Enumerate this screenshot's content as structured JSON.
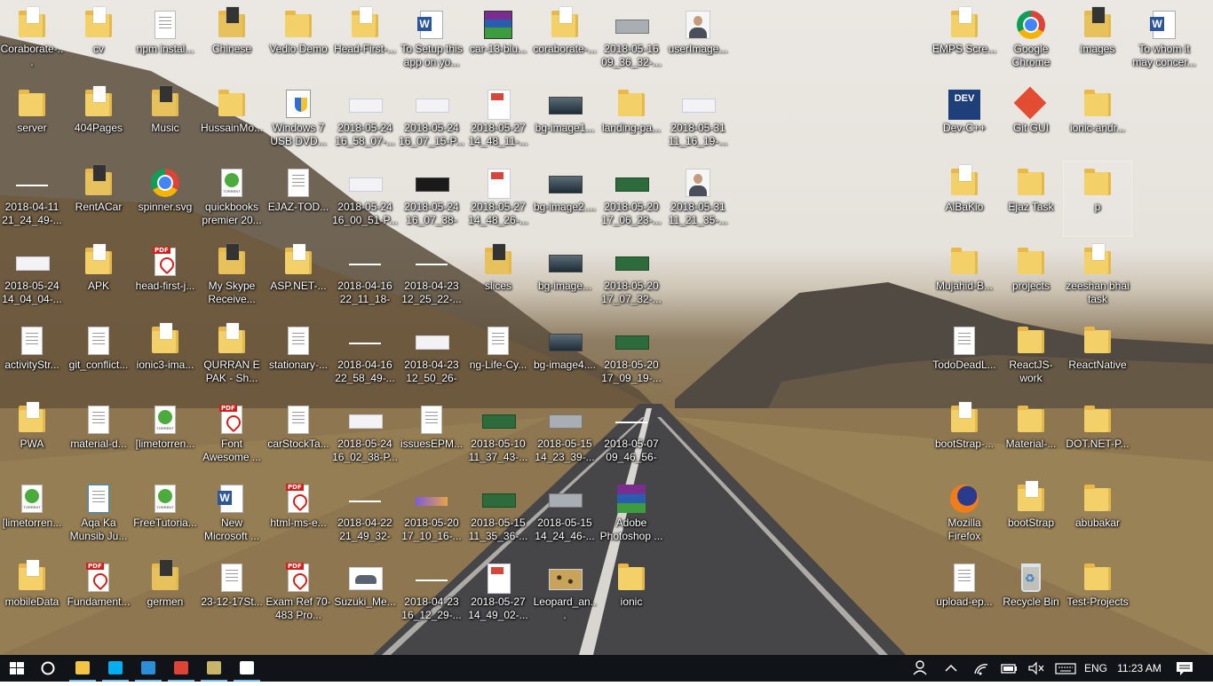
{
  "desktop": {
    "icons": [
      {
        "col": 0,
        "row": 0,
        "label": "Coraborate-...",
        "type": "folder-doc"
      },
      {
        "col": 1,
        "row": 0,
        "label": "cv",
        "type": "folder-doc"
      },
      {
        "col": 2,
        "row": 0,
        "label": "npm instal...",
        "type": "doc"
      },
      {
        "col": 3,
        "row": 0,
        "label": "Chinese",
        "type": "folder-media"
      },
      {
        "col": 4,
        "row": 0,
        "label": "Vedio Demo",
        "type": "folder"
      },
      {
        "col": 5,
        "row": 0,
        "label": "Head-First-...",
        "type": "folder-doc"
      },
      {
        "col": 6,
        "row": 0,
        "label": "To Setup this app on yo...",
        "type": "word"
      },
      {
        "col": 7,
        "row": 0,
        "label": "car-13-blu...",
        "type": "winrar"
      },
      {
        "col": 8,
        "row": 0,
        "label": "coraborate-...",
        "type": "folder-doc"
      },
      {
        "col": 9,
        "row": 0,
        "label": "2018-05-16 09_36_32-...",
        "type": "thumb-grey"
      },
      {
        "col": 10,
        "row": 0,
        "label": "userImage...",
        "type": "avatar"
      },
      {
        "col": 0,
        "row": 1,
        "label": "server",
        "type": "folder"
      },
      {
        "col": 1,
        "row": 1,
        "label": "404Pages",
        "type": "folder-doc"
      },
      {
        "col": 2,
        "row": 1,
        "label": "Music",
        "type": "folder-media"
      },
      {
        "col": 3,
        "row": 1,
        "label": "HussainMo...",
        "type": "folder"
      },
      {
        "col": 4,
        "row": 1,
        "label": "Windows 7 USB DVD...",
        "type": "shield"
      },
      {
        "col": 5,
        "row": 1,
        "label": "2018-05-24 16_58_07-...",
        "type": "thumb"
      },
      {
        "col": 6,
        "row": 1,
        "label": "2018-05-24 16_07_15-P...",
        "type": "thumb"
      },
      {
        "col": 7,
        "row": 1,
        "label": "2018-05-27 14_48_11-...",
        "type": "thumb-tall"
      },
      {
        "col": 8,
        "row": 1,
        "label": "bg-image1...",
        "type": "thumb-photo"
      },
      {
        "col": 9,
        "row": 1,
        "label": "landing-pa...",
        "type": "folder"
      },
      {
        "col": 10,
        "row": 1,
        "label": "2018-05-31 11_16_19-...",
        "type": "thumb"
      },
      {
        "col": 0,
        "row": 2,
        "label": "2018-04-11 21_24_49-...",
        "type": "thumb-line"
      },
      {
        "col": 1,
        "row": 2,
        "label": "RentACar",
        "type": "folder-media"
      },
      {
        "col": 2,
        "row": 2,
        "label": "spinner.svg",
        "type": "chrome"
      },
      {
        "col": 3,
        "row": 2,
        "label": "quickbooks premier 20...",
        "type": "torrent"
      },
      {
        "col": 4,
        "row": 2,
        "label": "EJAZ-TOD...",
        "type": "doc"
      },
      {
        "col": 5,
        "row": 2,
        "label": "2018-05-24 16_00_51-P...",
        "type": "thumb"
      },
      {
        "col": 6,
        "row": 2,
        "label": "2018-05-24 16_07_38-H...",
        "type": "thumb-dark"
      },
      {
        "col": 7,
        "row": 2,
        "label": "2018-05-27 14_48_26-...",
        "type": "thumb-tall"
      },
      {
        "col": 8,
        "row": 2,
        "label": "bg-image2....",
        "type": "thumb-photo"
      },
      {
        "col": 9,
        "row": 2,
        "label": "2018-05-20 17_06_23-...",
        "type": "thumb-green"
      },
      {
        "col": 10,
        "row": 2,
        "label": "2018-05-31 11_21_35-...",
        "type": "avatar"
      },
      {
        "col": 0,
        "row": 3,
        "label": "2018-05-24 14_04_04-...",
        "type": "thumb"
      },
      {
        "col": 1,
        "row": 3,
        "label": "APK",
        "type": "folder-doc"
      },
      {
        "col": 2,
        "row": 3,
        "label": "head-first-j...",
        "type": "pdf"
      },
      {
        "col": 3,
        "row": 3,
        "label": "My Skype Receive...",
        "type": "folder-media"
      },
      {
        "col": 4,
        "row": 3,
        "label": "ASP.NET-...",
        "type": "folder-doc"
      },
      {
        "col": 5,
        "row": 3,
        "label": "2018-04-16 22_11_18-M...",
        "type": "thumb-line"
      },
      {
        "col": 6,
        "row": 3,
        "label": "2018-04-23 12_25_22-...",
        "type": "thumb-line"
      },
      {
        "col": 7,
        "row": 3,
        "label": "slices",
        "type": "folder-media"
      },
      {
        "col": 8,
        "row": 3,
        "label": "bg-image...",
        "type": "thumb-photo"
      },
      {
        "col": 9,
        "row": 3,
        "label": "2018-05-20 17_07_32-...",
        "type": "thumb-green"
      },
      {
        "col": 0,
        "row": 4,
        "label": "activityStr...",
        "type": "doc"
      },
      {
        "col": 1,
        "row": 4,
        "label": "git_conflict...",
        "type": "doc"
      },
      {
        "col": 2,
        "row": 4,
        "label": "ionic3-ima...",
        "type": "folder-doc"
      },
      {
        "col": 3,
        "row": 4,
        "label": "QURRAN E PAK - Sh...",
        "type": "folder-doc"
      },
      {
        "col": 4,
        "row": 4,
        "label": "stationary-...",
        "type": "doc"
      },
      {
        "col": 5,
        "row": 4,
        "label": "2018-04-16 22_58_49-...",
        "type": "thumb-line"
      },
      {
        "col": 6,
        "row": 4,
        "label": "2018-04-23 12_50_26-M...",
        "type": "thumb"
      },
      {
        "col": 7,
        "row": 4,
        "label": "ng-Life-Cy...",
        "type": "doc"
      },
      {
        "col": 8,
        "row": 4,
        "label": "bg-image4....",
        "type": "thumb-photo"
      },
      {
        "col": 9,
        "row": 4,
        "label": "2018-05-20 17_09_19-...",
        "type": "thumb-green"
      },
      {
        "col": 0,
        "row": 5,
        "label": "PWA",
        "type": "folder-doc"
      },
      {
        "col": 1,
        "row": 5,
        "label": "material-d...",
        "type": "doc"
      },
      {
        "col": 2,
        "row": 5,
        "label": "[limetorren...",
        "type": "torrent"
      },
      {
        "col": 3,
        "row": 5,
        "label": "Font Awesome ...",
        "type": "pdf"
      },
      {
        "col": 4,
        "row": 5,
        "label": "carStockTa...",
        "type": "doc"
      },
      {
        "col": 5,
        "row": 5,
        "label": "2018-05-24 16_02_38-P...",
        "type": "thumb"
      },
      {
        "col": 6,
        "row": 5,
        "label": "issuesEPM...",
        "type": "doc"
      },
      {
        "col": 7,
        "row": 5,
        "label": "2018-05-10 11_37_43-...",
        "type": "thumb-green"
      },
      {
        "col": 8,
        "row": 5,
        "label": "2018-05-15 14_23_39-...",
        "type": "thumb-grey"
      },
      {
        "col": 9,
        "row": 5,
        "label": "2018-05-07 09_46_56-ht...",
        "type": "thumb-line"
      },
      {
        "col": 0,
        "row": 6,
        "label": "[limetorren...",
        "type": "torrent"
      },
      {
        "col": 1,
        "row": 6,
        "label": "Aqa Ka Munsib Ju...",
        "type": "doc-blue"
      },
      {
        "col": 2,
        "row": 6,
        "label": "FreeTutoria...",
        "type": "torrent"
      },
      {
        "col": 3,
        "row": 6,
        "label": "New Microsoft ...",
        "type": "word"
      },
      {
        "col": 4,
        "row": 6,
        "label": "html-ms-e...",
        "type": "pdf"
      },
      {
        "col": 5,
        "row": 6,
        "label": "2018-04-22 21_49_32-H...",
        "type": "thumb-line"
      },
      {
        "col": 6,
        "row": 6,
        "label": "2018-05-20 17_10_16-...",
        "type": "thumb-bright"
      },
      {
        "col": 7,
        "row": 6,
        "label": "2018-05-15 11_35_36-...",
        "type": "thumb-green"
      },
      {
        "col": 8,
        "row": 6,
        "label": "2018-05-15 14_24_46-...",
        "type": "thumb-grey"
      },
      {
        "col": 9,
        "row": 6,
        "label": "Adobe Photoshop ...",
        "type": "ps"
      },
      {
        "col": 0,
        "row": 7,
        "label": "mobileData",
        "type": "folder-doc"
      },
      {
        "col": 1,
        "row": 7,
        "label": "Fundament...",
        "type": "pdf"
      },
      {
        "col": 2,
        "row": 7,
        "label": "germen",
        "type": "folder-media"
      },
      {
        "col": 3,
        "row": 7,
        "label": "23-12-17St...",
        "type": "doc"
      },
      {
        "col": 4,
        "row": 7,
        "label": "Exam Ref 70-483 Pro...",
        "type": "pdf"
      },
      {
        "col": 5,
        "row": 7,
        "label": "Suzuki_Me...",
        "type": "thumb-car"
      },
      {
        "col": 6,
        "row": 7,
        "label": "2018-04-23 16_12_29-...",
        "type": "thumb-line"
      },
      {
        "col": 7,
        "row": 7,
        "label": "2018-05-27 14_49_02-...",
        "type": "thumb-tall"
      },
      {
        "col": 8,
        "row": 7,
        "label": "Leopard_an...",
        "type": "thumb-leopard"
      },
      {
        "col": 9,
        "row": 7,
        "label": "ionic",
        "type": "folder"
      }
    ],
    "right_icons": [
      {
        "col": 0,
        "row": 0,
        "label": "EMPS Scre...",
        "type": "folder-doc"
      },
      {
        "col": 1,
        "row": 0,
        "label": "Google Chrome",
        "type": "chrome"
      },
      {
        "col": 2,
        "row": 0,
        "label": "images",
        "type": "folder-media"
      },
      {
        "col": 3,
        "row": 0,
        "label": "To whom it may concer...",
        "type": "word"
      },
      {
        "col": 0,
        "row": 1,
        "label": "Dev-C++",
        "type": "dev"
      },
      {
        "col": 1,
        "row": 1,
        "label": "Git GUI",
        "type": "git"
      },
      {
        "col": 2,
        "row": 1,
        "label": "ionic-andr...",
        "type": "folder"
      },
      {
        "col": 0,
        "row": 2,
        "label": "AlBaKio",
        "type": "folder-doc"
      },
      {
        "col": 1,
        "row": 2,
        "label": "Ejaz Task",
        "type": "folder"
      },
      {
        "col": 2,
        "row": 2,
        "label": "p",
        "type": "folder",
        "selected": true
      },
      {
        "col": 0,
        "row": 3,
        "label": "Mujahid-B...",
        "type": "folder"
      },
      {
        "col": 1,
        "row": 3,
        "label": "projects",
        "type": "folder"
      },
      {
        "col": 2,
        "row": 3,
        "label": "zeeshan bhai task",
        "type": "folder-doc"
      },
      {
        "col": 0,
        "row": 4,
        "label": "TodoDeadL...",
        "type": "doc"
      },
      {
        "col": 1,
        "row": 4,
        "label": "ReactJS-work",
        "type": "folder"
      },
      {
        "col": 2,
        "row": 4,
        "label": "ReactNative",
        "type": "folder"
      },
      {
        "col": 0,
        "row": 5,
        "label": "bootStrap-...",
        "type": "folder-doc"
      },
      {
        "col": 1,
        "row": 5,
        "label": "Material-...",
        "type": "folder"
      },
      {
        "col": 2,
        "row": 5,
        "label": "DOT.NET-P...",
        "type": "folder"
      },
      {
        "col": 0,
        "row": 6,
        "label": "Mozilla Firefox",
        "type": "firefox"
      },
      {
        "col": 1,
        "row": 6,
        "label": "bootStrap",
        "type": "folder-doc"
      },
      {
        "col": 2,
        "row": 6,
        "label": "abubakar",
        "type": "folder"
      },
      {
        "col": 0,
        "row": 7,
        "label": "upload-ep...",
        "type": "doc"
      },
      {
        "col": 1,
        "row": 7,
        "label": "Recycle Bin",
        "type": "recycle"
      },
      {
        "col": 2,
        "row": 7,
        "label": "Test-Projects",
        "type": "folder"
      }
    ]
  },
  "taskbar": {
    "pinned": [
      {
        "name": "file-explorer-icon",
        "color": "#f4c542"
      },
      {
        "name": "skype-icon",
        "color": "#00aff0"
      },
      {
        "name": "vscode-icon",
        "color": "#2c8ed6"
      },
      {
        "name": "chrome-icon",
        "color": "#db4437"
      },
      {
        "name": "editor-e-icon",
        "color": "#c9b56a"
      },
      {
        "name": "photos-icon",
        "color": "#ffffff"
      }
    ],
    "language": "ENG",
    "time": "11:23 AM"
  }
}
